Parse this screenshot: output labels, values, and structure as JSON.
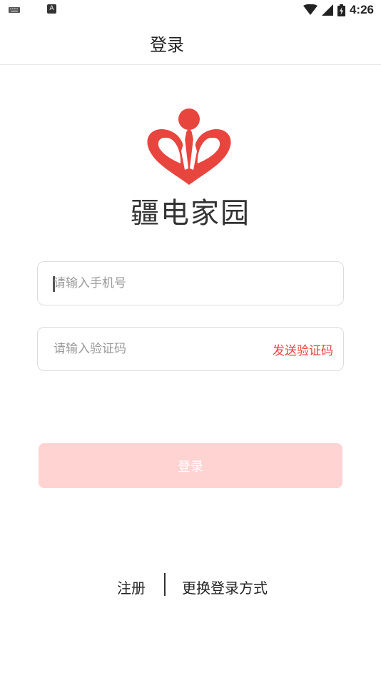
{
  "status_bar": {
    "time": "4:26",
    "a_badge": "A"
  },
  "header": {
    "title": "登录"
  },
  "brand": {
    "name": "疆电家园",
    "accent_color": "#e9453f"
  },
  "form": {
    "phone_placeholder": "请输入手机号",
    "phone_value": "",
    "code_placeholder": "请输入验证码",
    "code_value": "",
    "send_code_label": "发送验证码",
    "submit_label": "登录"
  },
  "footer": {
    "register_label": "注册",
    "switch_login_label": "更换登录方式"
  }
}
